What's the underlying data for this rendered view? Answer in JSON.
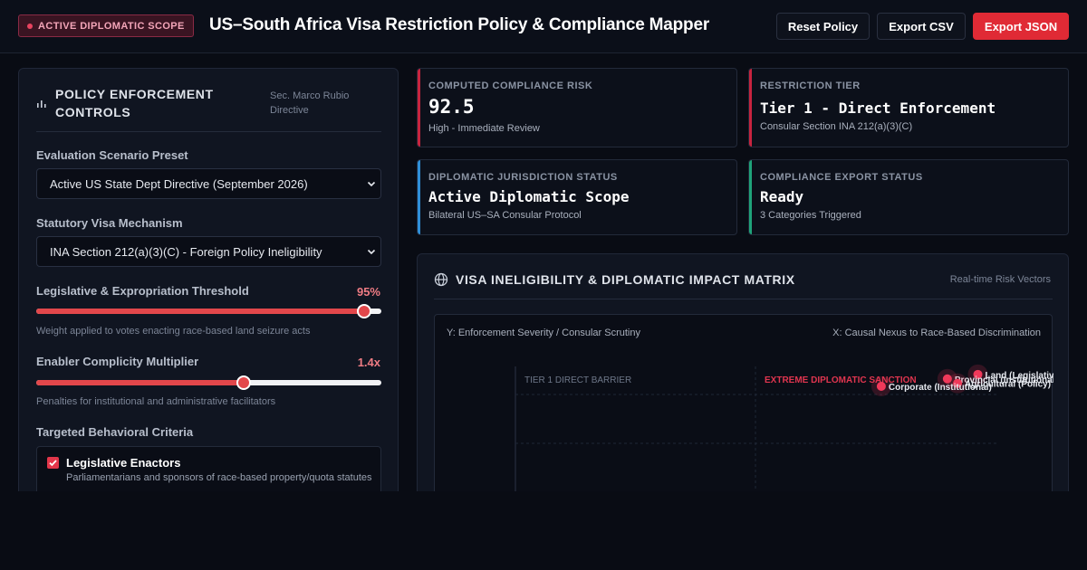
{
  "header": {
    "badge": "ACTIVE DIPLOMATIC SCOPE",
    "title": "US–South Africa Visa Restriction Policy & Compliance Mapper",
    "buttons": {
      "reset": "Reset Policy",
      "export_csv": "Export CSV",
      "export_json": "Export JSON"
    }
  },
  "controls": {
    "title": "POLICY ENFORCEMENT CONTROLS",
    "subtitle": "Sec. Marco Rubio Directive",
    "scenario": {
      "label": "Evaluation Scenario Preset",
      "value": "Active US State Dept Directive (September 2026)"
    },
    "mechanism": {
      "label": "Statutory Visa Mechanism",
      "value": "INA Section 212(a)(3)(C) - Foreign Policy Ineligibility"
    },
    "threshold": {
      "label": "Legislative & Expropriation Threshold",
      "display": "95%",
      "value": 0.95,
      "helper": "Weight applied to votes enacting race-based land seizure acts"
    },
    "multiplier": {
      "label": "Enabler Complicity Multiplier",
      "display": "1.4x",
      "value": 0.6,
      "helper": "Penalties for institutional and administrative facilitators"
    },
    "criteria": {
      "label": "Targeted Behavioral Criteria",
      "items": [
        {
          "title": "Legislative Enactors",
          "desc": "Parliamentarians and sponsors of race-based property/quota statutes",
          "checked": true
        }
      ]
    }
  },
  "cards": {
    "risk": {
      "label": "COMPUTED COMPLIANCE RISK",
      "value": "92.5",
      "note": "High - Immediate Review",
      "accent": "#c8243f"
    },
    "tier": {
      "label": "RESTRICTION TIER",
      "value": "Tier 1 - Direct Enforcement",
      "note": "Consular Section INA 212(a)(3)(C)",
      "accent": "#c8243f"
    },
    "jurisdiction": {
      "label": "DIPLOMATIC JURISDICTION STATUS",
      "value": "Active Diplomatic Scope",
      "note": "Bilateral US–SA Consular Protocol",
      "accent": "#2f8fd8"
    },
    "export": {
      "label": "COMPLIANCE EXPORT STATUS",
      "value": "Ready",
      "note": "3 Categories Triggered",
      "accent": "#1fa37a"
    }
  },
  "matrix": {
    "title": "VISA INELIGIBILITY & DIPLOMATIC IMPACT MATRIX",
    "subtitle": "Real-time Risk Vectors",
    "y_axis": "Y: Enforcement Severity / Consular Scrutiny",
    "x_axis": "X: Causal Nexus to Race-Based Discrimination",
    "zones": {
      "left": "TIER 1 DIRECT BARRIER",
      "right": "EXTREME DIPLOMATIC SANCTION"
    },
    "points": [
      {
        "label": "Land (Legislative)",
        "x": 0.91,
        "y": 0.94
      },
      {
        "label": "Provincial (Institutional)",
        "x": 0.85,
        "y": 0.91
      },
      {
        "label": "Agricultural (Policy)",
        "x": 0.87,
        "y": 0.88
      },
      {
        "label": "Corporate (Institutional)",
        "x": 0.72,
        "y": 0.86
      }
    ],
    "colors": {
      "point": "#f0395a",
      "zone_label": "#e0354f"
    }
  }
}
